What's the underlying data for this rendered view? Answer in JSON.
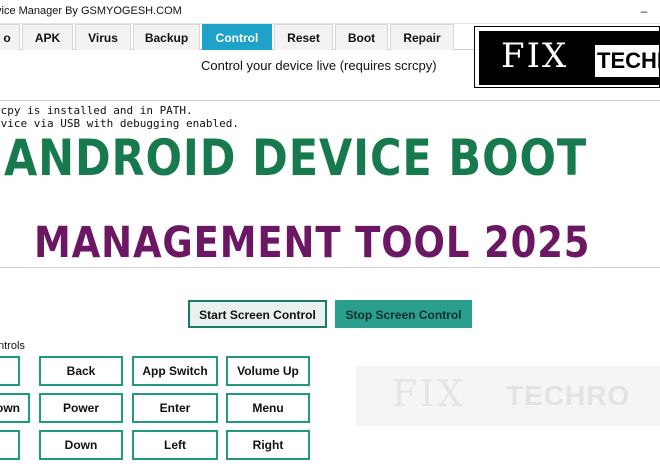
{
  "window": {
    "title": "vice Manager By GSMYOGESH.COM",
    "minimize_glyph": "–"
  },
  "tabs": [
    {
      "label": "o"
    },
    {
      "label": "APK"
    },
    {
      "label": "Virus"
    },
    {
      "label": "Backup"
    },
    {
      "label": "Control",
      "active": true
    },
    {
      "label": "Reset"
    },
    {
      "label": "Boot"
    },
    {
      "label": "Repair"
    }
  ],
  "control_panel": {
    "subtitle": "Control your device live (requires scrcpy)",
    "console_lines": [
      "rcpy is installed and in PATH.",
      "evice via USB with debugging enabled."
    ],
    "start_button": "Start Screen Control",
    "stop_button": "Stop Screen Control",
    "section_label": "ntrols",
    "keys": [
      "",
      "Back",
      "App Switch",
      "Volume Up",
      "own",
      "Power",
      "Enter",
      "Menu",
      "",
      "Down",
      "Left",
      "Right"
    ]
  },
  "overlay": {
    "headline_1": "ANDROID DEVICE BOOT",
    "headline_2": "MANAGEMENT TOOL 2025",
    "logo_fix": "FIX",
    "logo_techro": "TECHRO",
    "watermark_fix": "FIX",
    "watermark_techro": "TECHRO"
  },
  "colors": {
    "active_tab": "#1fa2c9",
    "headline_green": "#17794e",
    "headline_purple": "#6b1763",
    "stop_button": "#2a9f90",
    "key_border": "#1f9a7e"
  }
}
